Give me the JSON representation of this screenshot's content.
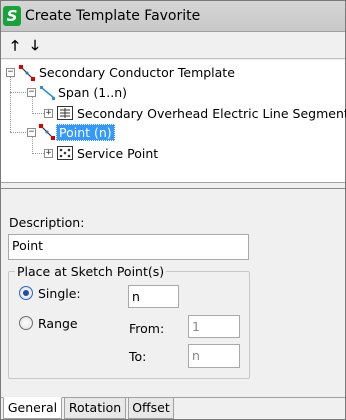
{
  "window": {
    "title": "Create Template Favorite"
  },
  "toolbar": {
    "up_icon": "arrow-up-icon",
    "down_icon": "arrow-down-icon",
    "up_glyph": "🡑",
    "down_glyph": "🡓"
  },
  "tree": {
    "root": {
      "label": "Secondary Conductor Template",
      "expander": "−"
    },
    "span": {
      "label": "Span (1..n)",
      "expander": "−"
    },
    "segment": {
      "label": "Secondary Overhead Electric Line Segment",
      "expander": "+"
    },
    "point": {
      "label": "Point (n)",
      "expander": "−"
    },
    "service_point": {
      "label": "Service Point",
      "expander": "+"
    }
  },
  "form": {
    "description_label": "Description:",
    "description_value": "Point",
    "group_title": "Place at Sketch Point(s)",
    "single_label": "Single:",
    "single_value": "n",
    "range_label": "Range",
    "from_label": "From:",
    "from_value": "1",
    "to_label": "To:",
    "to_value": "n",
    "selected_mode": "single"
  },
  "tabs": [
    {
      "label": "General",
      "active": true
    },
    {
      "label": "Rotation",
      "active": false
    },
    {
      "label": "Offset",
      "active": false
    }
  ],
  "colors": {
    "selection": "#3399ff",
    "app_icon": "#1aa23a"
  }
}
